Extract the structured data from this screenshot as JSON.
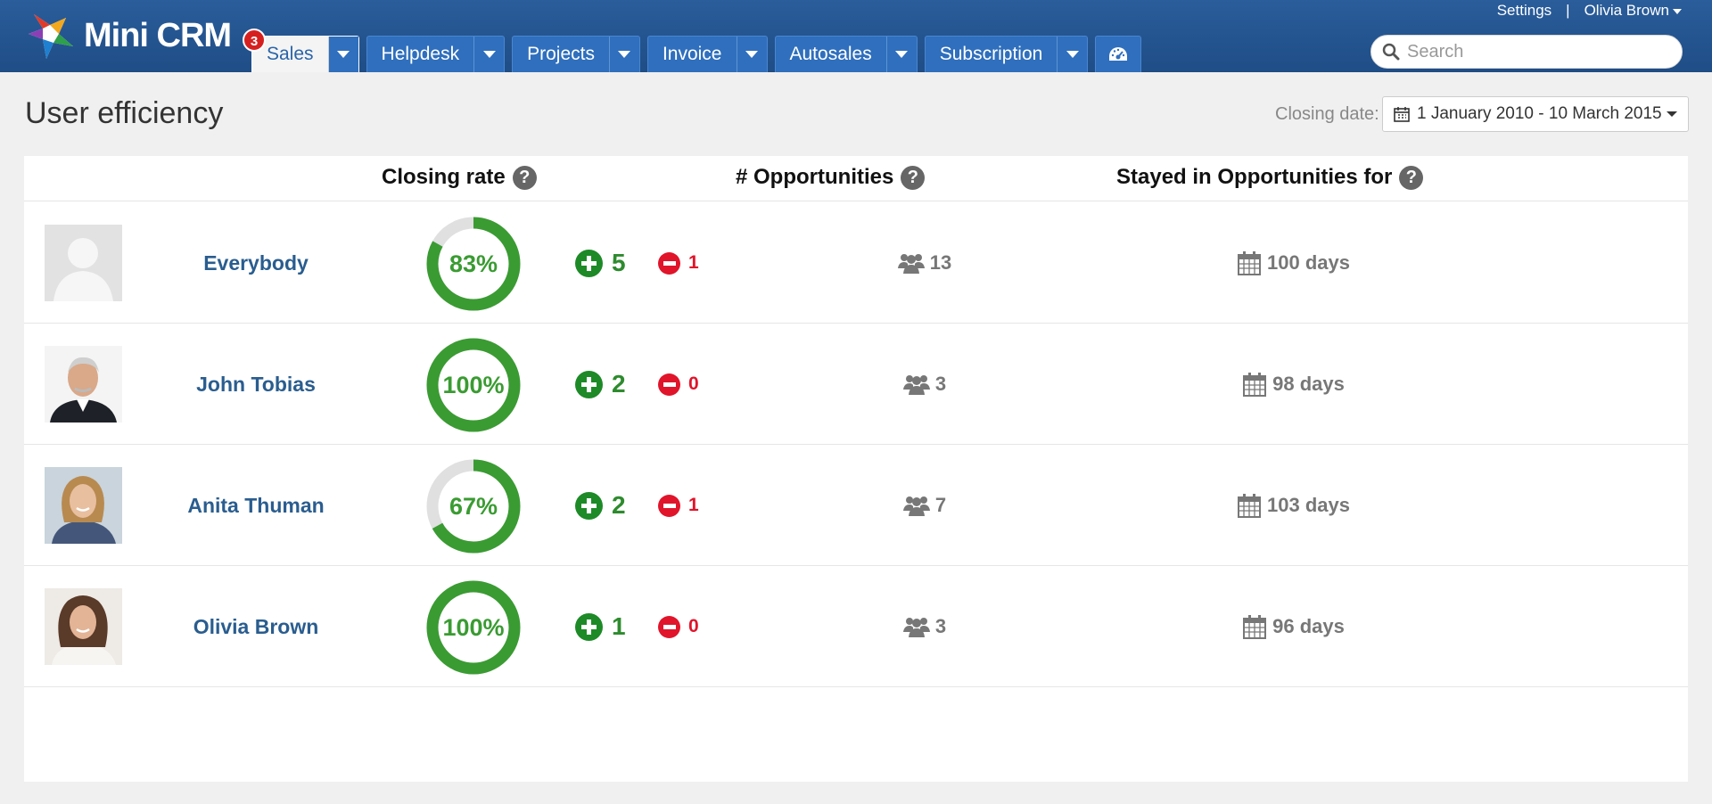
{
  "app": {
    "name": "Mini CRM",
    "notification_count": "3"
  },
  "nav": {
    "tabs": [
      {
        "label": "Sales",
        "active": true
      },
      {
        "label": "Helpdesk"
      },
      {
        "label": "Projects"
      },
      {
        "label": "Invoice"
      },
      {
        "label": "Autosales"
      },
      {
        "label": "Subscription"
      }
    ],
    "dashboard_icon": "dashboard-icon"
  },
  "toplinks": {
    "settings": "Settings",
    "separator": "|",
    "user": "Olivia Brown"
  },
  "search": {
    "placeholder": "Search",
    "value": ""
  },
  "page": {
    "title": "User efficiency",
    "closing_label": "Closing date:",
    "date_range": "1 January 2010 - 10 March 2015"
  },
  "table": {
    "headers": {
      "closing_rate": "Closing rate",
      "opportunities": "# Opportunities",
      "stayed": "Stayed in Opportunities for"
    },
    "rows": [
      {
        "name": "Everybody",
        "rate": 83,
        "rate_label": "83%",
        "won": "5",
        "lost": "1",
        "opps": "13",
        "days": "100 days",
        "avatar": "placeholder"
      },
      {
        "name": "John Tobias",
        "rate": 100,
        "rate_label": "100%",
        "won": "2",
        "lost": "0",
        "opps": "3",
        "days": "98 days",
        "avatar": "man"
      },
      {
        "name": "Anita Thuman",
        "rate": 67,
        "rate_label": "67%",
        "won": "2",
        "lost": "1",
        "opps": "7",
        "days": "103 days",
        "avatar": "woman-blonde"
      },
      {
        "name": "Olivia Brown",
        "rate": 100,
        "rate_label": "100%",
        "won": "1",
        "lost": "0",
        "opps": "3",
        "days": "96 days",
        "avatar": "woman-brunette"
      }
    ]
  },
  "colors": {
    "header": "#2a5d9b",
    "won": "#1d8a27",
    "lost": "#e0142a",
    "donut_fill": "#3a9b32",
    "donut_track": "#e0e0e0",
    "name": "#2a5d8f"
  }
}
